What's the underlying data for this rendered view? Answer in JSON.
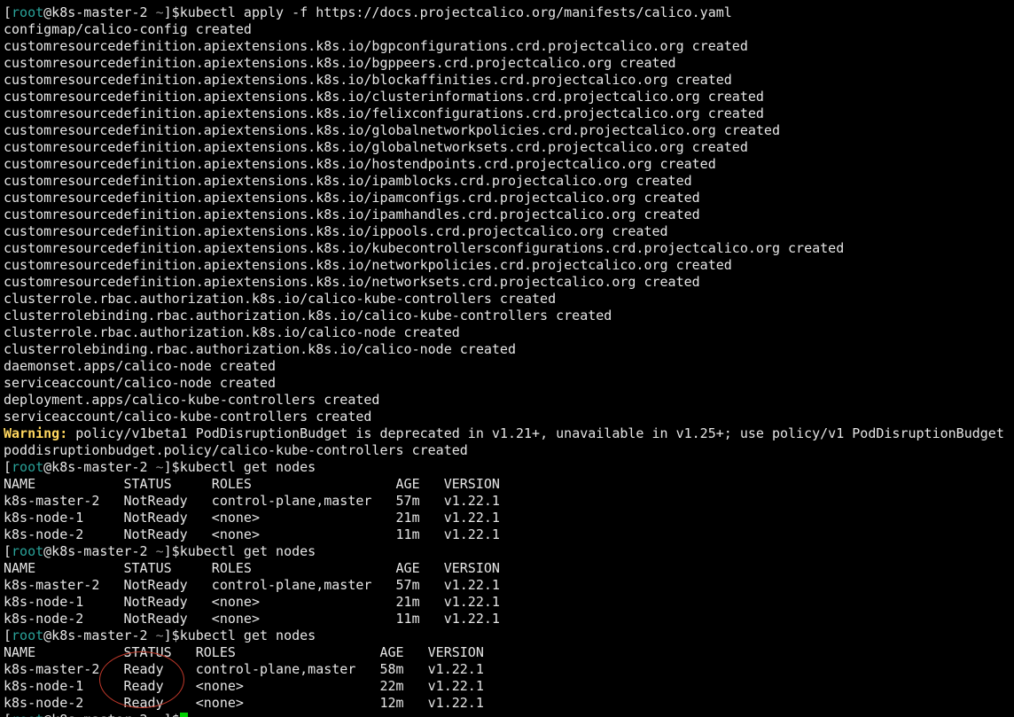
{
  "prompt": {
    "user": "root",
    "host_part": "@k8s-master-2",
    "path": "~",
    "symbol": "$"
  },
  "lines": [
    {
      "type": "prompt",
      "cmd": "kubectl apply -f https://docs.projectcalico.org/manifests/calico.yaml"
    },
    {
      "type": "out",
      "text": "configmap/calico-config created"
    },
    {
      "type": "out",
      "text": "customresourcedefinition.apiextensions.k8s.io/bgpconfigurations.crd.projectcalico.org created"
    },
    {
      "type": "out",
      "text": "customresourcedefinition.apiextensions.k8s.io/bgppeers.crd.projectcalico.org created"
    },
    {
      "type": "out",
      "text": "customresourcedefinition.apiextensions.k8s.io/blockaffinities.crd.projectcalico.org created"
    },
    {
      "type": "out",
      "text": "customresourcedefinition.apiextensions.k8s.io/clusterinformations.crd.projectcalico.org created"
    },
    {
      "type": "out",
      "text": "customresourcedefinition.apiextensions.k8s.io/felixconfigurations.crd.projectcalico.org created"
    },
    {
      "type": "out",
      "text": "customresourcedefinition.apiextensions.k8s.io/globalnetworkpolicies.crd.projectcalico.org created"
    },
    {
      "type": "out",
      "text": "customresourcedefinition.apiextensions.k8s.io/globalnetworksets.crd.projectcalico.org created"
    },
    {
      "type": "out",
      "text": "customresourcedefinition.apiextensions.k8s.io/hostendpoints.crd.projectcalico.org created"
    },
    {
      "type": "out",
      "text": "customresourcedefinition.apiextensions.k8s.io/ipamblocks.crd.projectcalico.org created"
    },
    {
      "type": "out",
      "text": "customresourcedefinition.apiextensions.k8s.io/ipamconfigs.crd.projectcalico.org created"
    },
    {
      "type": "out",
      "text": "customresourcedefinition.apiextensions.k8s.io/ipamhandles.crd.projectcalico.org created"
    },
    {
      "type": "out",
      "text": "customresourcedefinition.apiextensions.k8s.io/ippools.crd.projectcalico.org created"
    },
    {
      "type": "out",
      "text": "customresourcedefinition.apiextensions.k8s.io/kubecontrollersconfigurations.crd.projectcalico.org created"
    },
    {
      "type": "out",
      "text": "customresourcedefinition.apiextensions.k8s.io/networkpolicies.crd.projectcalico.org created"
    },
    {
      "type": "out",
      "text": "customresourcedefinition.apiextensions.k8s.io/networksets.crd.projectcalico.org created"
    },
    {
      "type": "out",
      "text": "clusterrole.rbac.authorization.k8s.io/calico-kube-controllers created"
    },
    {
      "type": "out",
      "text": "clusterrolebinding.rbac.authorization.k8s.io/calico-kube-controllers created"
    },
    {
      "type": "out",
      "text": "clusterrole.rbac.authorization.k8s.io/calico-node created"
    },
    {
      "type": "out",
      "text": "clusterrolebinding.rbac.authorization.k8s.io/calico-node created"
    },
    {
      "type": "out",
      "text": "daemonset.apps/calico-node created"
    },
    {
      "type": "out",
      "text": "serviceaccount/calico-node created"
    },
    {
      "type": "out",
      "text": "deployment.apps/calico-kube-controllers created"
    },
    {
      "type": "out",
      "text": "serviceaccount/calico-kube-controllers created"
    },
    {
      "type": "warn",
      "label": "Warning:",
      "text": " policy/v1beta1 PodDisruptionBudget is deprecated in v1.21+, unavailable in v1.25+; use policy/v1 PodDisruptionBudget"
    },
    {
      "type": "out",
      "text": "poddisruptionbudget.policy/calico-kube-controllers created"
    },
    {
      "type": "prompt",
      "cmd": "kubectl get nodes"
    },
    {
      "type": "out",
      "text": "NAME           STATUS     ROLES                  AGE   VERSION"
    },
    {
      "type": "out",
      "text": "k8s-master-2   NotReady   control-plane,master   57m   v1.22.1"
    },
    {
      "type": "out",
      "text": "k8s-node-1     NotReady   <none>                 21m   v1.22.1"
    },
    {
      "type": "out",
      "text": "k8s-node-2     NotReady   <none>                 11m   v1.22.1"
    },
    {
      "type": "prompt",
      "cmd": "kubectl get nodes"
    },
    {
      "type": "out",
      "text": "NAME           STATUS     ROLES                  AGE   VERSION"
    },
    {
      "type": "out",
      "text": "k8s-master-2   NotReady   control-plane,master   57m   v1.22.1"
    },
    {
      "type": "out",
      "text": "k8s-node-1     NotReady   <none>                 21m   v1.22.1"
    },
    {
      "type": "out",
      "text": "k8s-node-2     NotReady   <none>                 11m   v1.22.1"
    },
    {
      "type": "prompt",
      "cmd": "kubectl get nodes"
    },
    {
      "type": "out",
      "text": "NAME           STATUS   ROLES                  AGE   VERSION"
    },
    {
      "type": "out",
      "text": "k8s-master-2   Ready    control-plane,master   58m   v1.22.1"
    },
    {
      "type": "out",
      "text": "k8s-node-1     Ready    <none>                 22m   v1.22.1"
    },
    {
      "type": "out",
      "text": "k8s-node-2     Ready    <none>                 12m   v1.22.1"
    },
    {
      "type": "prompt",
      "cmd": "",
      "cursor": true
    }
  ],
  "colors": {
    "background": "#000000",
    "foreground": "#e6e6e6",
    "prompt_user": "#2aa198",
    "warning": "#ffd75f",
    "cursor": "#00d000",
    "annotation": "#c0392b"
  }
}
